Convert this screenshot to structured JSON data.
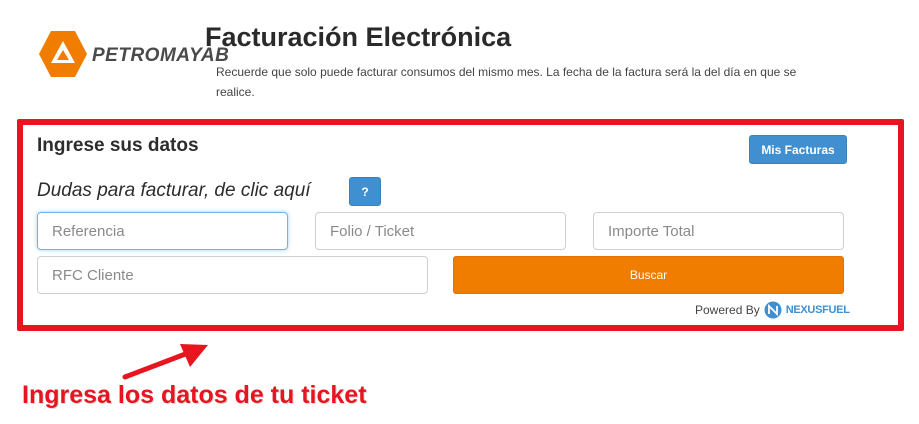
{
  "brand": {
    "logo_text": "PETROMAYAB",
    "logo_color": "#f07c00"
  },
  "header": {
    "title": "Facturación Electrónica",
    "note": "Recuerde que solo puede facturar consumos del mismo mes. La fecha de la factura será la del día en que se realice."
  },
  "form": {
    "section_title": "Ingrese sus datos",
    "mis_facturas_label": "Mis Facturas",
    "help_text": "Dudas para facturar, de clic aquí",
    "help_button_label": "?",
    "fields": {
      "referencia": {
        "placeholder": "Referencia",
        "value": ""
      },
      "folio": {
        "placeholder": "Folio / Ticket",
        "value": ""
      },
      "importe": {
        "placeholder": "Importe Total",
        "value": ""
      },
      "rfc": {
        "placeholder": "RFC Cliente",
        "value": ""
      }
    },
    "search_label": "Buscar",
    "powered_by": "Powered By",
    "provider": "NEXUSFUEL"
  },
  "annotation": {
    "caption": "Ingresa los datos de tu ticket",
    "color": "#e8141f"
  },
  "colors": {
    "primary_button": "#3f8fd1",
    "search_button": "#f07c00",
    "highlight_border": "#e8141f"
  }
}
